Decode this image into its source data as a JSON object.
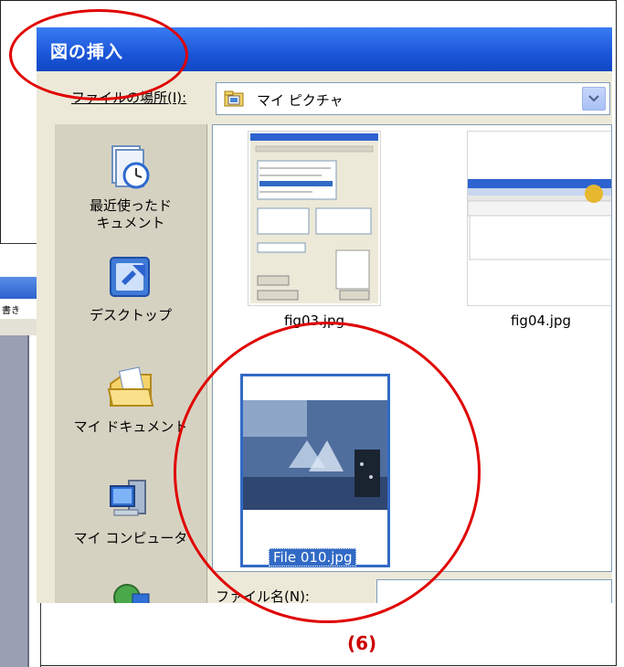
{
  "dialog": {
    "title": "図の挿入",
    "location_label": "ファイルの場所(I):",
    "location_value": "マイ ピクチャ",
    "filename_label": "ファイル名(N):",
    "filename_value": ""
  },
  "places": [
    {
      "label": "最近使ったド\nキュメント",
      "icon": "recent-documents-icon"
    },
    {
      "label": "デスクトップ",
      "icon": "desktop-icon"
    },
    {
      "label": "マイ ドキュメント",
      "icon": "my-documents-icon"
    },
    {
      "label": "マイ コンピュータ",
      "icon": "my-computer-icon"
    }
  ],
  "files": [
    {
      "name": "fig03.jpg"
    },
    {
      "name": "fig04.jpg"
    },
    {
      "name": "File 010.jpg",
      "selected": true
    }
  ],
  "background_window": {
    "text": "書き"
  },
  "caption": "(6)",
  "colors": {
    "titlebar": "#1b56d8",
    "dialog_bg": "#ece9d8",
    "places_bg": "#d6d2c2",
    "selection": "#316ac5",
    "annotation": "#e00000"
  }
}
